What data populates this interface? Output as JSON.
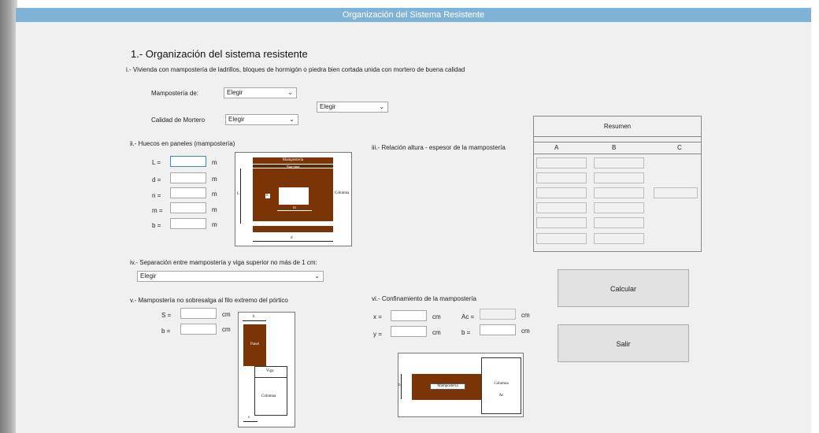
{
  "window": {
    "title": "Organización del Sistema Resistente"
  },
  "section1": {
    "title": "1.- Organización del sistema resistente",
    "i_text": "i.- Vivienda con mampostería de ladrillos, bloques de hormigón o piedra bien cortada unida con mortero de buena calidad",
    "mamposteria_label": "Mampostería de:",
    "mamposteria_value": "Elegir",
    "extra_value": "Elegir",
    "mortero_label": "Calidad de Mortero",
    "mortero_value": "Elegir"
  },
  "ii": {
    "title": "ii.- Huecos en paneles (mampostería)",
    "fields": [
      {
        "label": "L =",
        "unit": "m"
      },
      {
        "label": "d =",
        "unit": "m"
      },
      {
        "label": "n =",
        "unit": "m"
      },
      {
        "label": "m =",
        "unit": "m"
      },
      {
        "label": "b =",
        "unit": "m"
      }
    ],
    "fig": {
      "top": "Mampostería",
      "viga": "Viga-cinta",
      "col": "Columna",
      "L": "L",
      "n": "n",
      "m": "m",
      "d": "d",
      "b": "b"
    }
  },
  "iii": {
    "title": "iii.- Relación altura - espesor de la mampostería"
  },
  "resumen": {
    "title": "Resumen",
    "cols": [
      "A",
      "B",
      "C"
    ]
  },
  "iv": {
    "title": "iv.- Separación entre mampostería y viga superior no más de 1 cm:",
    "value": "Elegir"
  },
  "v": {
    "title": "v.- Mampostería no sobresalga al filo extremo del pórtico",
    "s_label": "S =",
    "s_unit": "cm",
    "b_label": "b =",
    "b_unit": "cm",
    "fig": {
      "b": "b",
      "panel": "Panel",
      "viga": "Viga",
      "col": "Columna",
      "s": "s"
    }
  },
  "vi": {
    "title": "vi.- Confinamiento de la mampostería",
    "x_label": "x =",
    "x_unit": "cm",
    "y_label": "y =",
    "y_unit": "cm",
    "ac_label": "Ac =",
    "ac_unit": "cm",
    "b_label": "b =",
    "b_unit": "cm",
    "fig": {
      "mamp": "Mampostería",
      "col1": "Columna",
      "col2": "Ac",
      "b": "b"
    }
  },
  "buttons": {
    "calcular": "Calcular",
    "salir": "Salir"
  },
  "colors": {
    "titlebar": "#7fb3d5",
    "brick": "#7a3406"
  }
}
